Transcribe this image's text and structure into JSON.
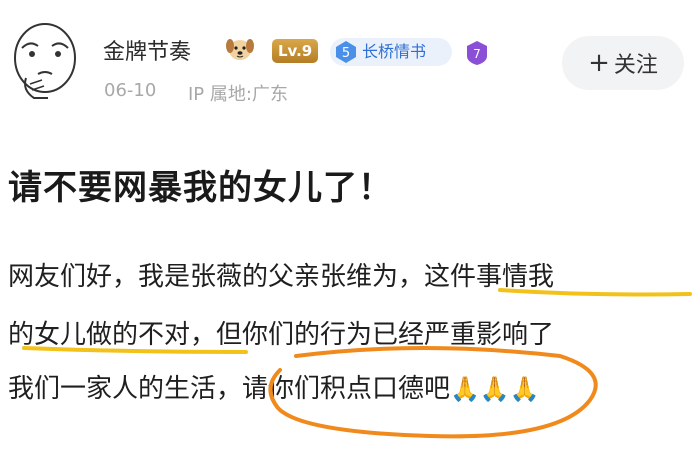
{
  "user": {
    "name": "金牌节奏",
    "level": "Lv.9",
    "club_number": "5",
    "club_name": "长桥情书",
    "purple_badge": "7",
    "date": "06-10",
    "ip_location": "IP 属地:广东"
  },
  "follow_button": {
    "plus": "+",
    "label": "关注"
  },
  "post": {
    "title": "请不要网暴我的女儿了！",
    "line1": "网友们好，我是张薇的父亲张维为，这件事情我",
    "line2": "的女儿做的不对，但你们的行为已经严重影响了",
    "line3": "我们一家人的生活，请你们积点口德吧",
    "emoji": "🙏🙏🙏"
  },
  "colors": {
    "highlight_underline": "#f2c21a",
    "circle_annotation": "#f08a1c",
    "club_text": "#2f6fd6"
  }
}
